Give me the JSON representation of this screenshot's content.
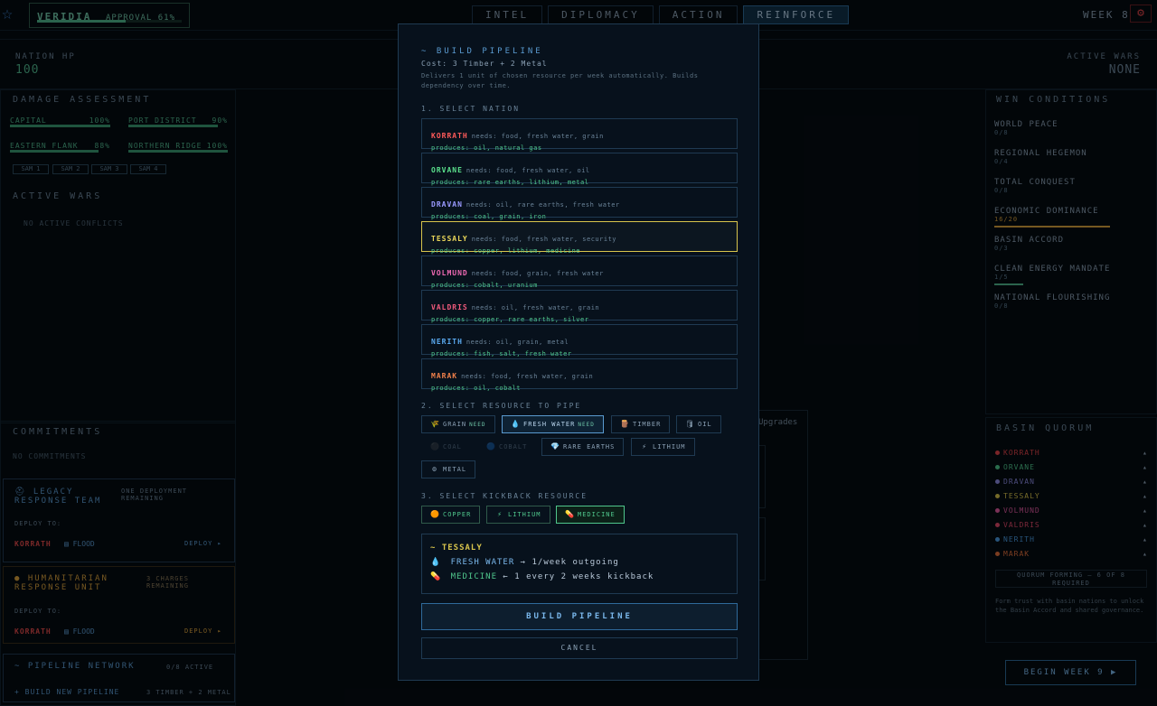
{
  "topbar": {
    "nation": "VERIDIA",
    "approval": "APPROVAL 61%",
    "approval_fill": 0.61,
    "tabs": [
      {
        "label": "INTEL",
        "active": false
      },
      {
        "label": "DIPLOMACY",
        "active": false
      },
      {
        "label": "ACTION",
        "active": false
      },
      {
        "label": "REINFORCE",
        "active": true
      }
    ],
    "week": "WEEK 8",
    "settings_icon": "gear-icon"
  },
  "stats": {
    "nation_hp_label": "NATION HP",
    "nation_hp": "100",
    "active_wars_label": "ACTIVE WARS",
    "active_wars": "NONE"
  },
  "damage": {
    "title": "DAMAGE ASSESSMENT",
    "regions": [
      {
        "name": "CAPITAL",
        "pct": "100%",
        "level": 1.0
      },
      {
        "name": "PORT DISTRICT",
        "pct": "90%",
        "level": 0.9
      },
      {
        "name": "EASTERN FLANK",
        "pct": "88%",
        "level": 0.88
      },
      {
        "name": "NORTHERN RIDGE",
        "pct": "100%",
        "level": 1.0
      }
    ],
    "sams": [
      "SAM 1",
      "SAM 2",
      "SAM 3",
      "SAM 4"
    ]
  },
  "wars": {
    "title": "ACTIVE WARS",
    "empty": "NO ACTIVE CONFLICTS"
  },
  "commitments": {
    "title": "COMMITMENTS",
    "empty": "NO COMMITMENTS",
    "units": [
      {
        "name": "LEGACY RESPONSE TEAM",
        "remaining": "ONE DEPLOYMENT REMAINING",
        "deploy_to": "DEPLOY TO:",
        "target": "KORRATH",
        "event": "FLOOD",
        "action": "DEPLOY ▸"
      },
      {
        "name": "HUMANITARIAN RESPONSE UNIT",
        "remaining": "3 CHARGES REMAINING",
        "deploy_to": "DEPLOY TO:",
        "target": "KORRATH",
        "event": "FLOOD",
        "action": "DEPLOY ▸"
      }
    ]
  },
  "pipeline_network": {
    "title": "~ PIPELINE NETWORK",
    "count": "0/8 ACTIVE",
    "build_link": "+ BUILD NEW PIPELINE",
    "build_cost": "3 TIMBER + 2 METAL"
  },
  "center_bg": {
    "tab": "Upgrades"
  },
  "win_conditions": {
    "title": "WIN CONDITIONS",
    "items": [
      {
        "name": "WORLD PEACE",
        "sub": "0/8",
        "level": 0,
        "color": "#4fb68c"
      },
      {
        "name": "REGIONAL HEGEMON",
        "sub": "0/4",
        "level": 0,
        "color": "#4fb68c"
      },
      {
        "name": "TOTAL CONQUEST",
        "sub": "0/8",
        "level": 0,
        "color": "#4fb68c"
      },
      {
        "name": "ECONOMIC DOMINANCE",
        "sub": "16/20",
        "level": 0.8,
        "color": "#d8a03c"
      },
      {
        "name": "BASIN ACCORD",
        "sub": "0/3",
        "level": 0,
        "color": "#4fb68c"
      },
      {
        "name": "CLEAN ENERGY MANDATE",
        "sub": "1/5",
        "level": 0.2,
        "color": "#4fb68c"
      },
      {
        "name": "NATIONAL FLOURISHING",
        "sub": "0/8",
        "level": 0,
        "color": "#4fb68c"
      }
    ]
  },
  "quorum": {
    "title": "BASIN QUORUM",
    "nations": [
      {
        "name": "KORRATH",
        "color": "#e0444a"
      },
      {
        "name": "ORVANE",
        "color": "#4fc68c"
      },
      {
        "name": "DRAVAN",
        "color": "#8a8ae0"
      },
      {
        "name": "TESSALY",
        "color": "#d8c44c"
      },
      {
        "name": "VOLMUND",
        "color": "#e05aa0"
      },
      {
        "name": "VALDRIS",
        "color": "#e04a6a"
      },
      {
        "name": "NERITH",
        "color": "#4a9ae0"
      },
      {
        "name": "MARAK",
        "color": "#e0703c"
      }
    ],
    "note_title": "QUORUM FORMING — 6 OF 8 REQUIRED",
    "note": "Form trust with basin nations to unlock the Basin Accord and shared governance.",
    "begin": "BEGIN WEEK 9 ▶"
  },
  "modal": {
    "title": "~ BUILD PIPELINE",
    "cost": "Cost: 3 Timber + 2 Metal",
    "desc": "Delivers 1 unit of chosen resource per week automatically. Builds dependency over time.",
    "sec1": "1. SELECT NATION",
    "nations": [
      {
        "name": "KORRATH",
        "color": "#ff5a5a",
        "needs": "needs: food, fresh water, grain",
        "produces": "produces: oil, natural gas",
        "selected": false
      },
      {
        "name": "ORVANE",
        "color": "#5ae08c",
        "needs": "needs: food, fresh water, oil",
        "produces": "produces: rare earths, lithium, metal",
        "selected": false
      },
      {
        "name": "DRAVAN",
        "color": "#9a9aff",
        "needs": "needs: oil, rare earths, fresh water",
        "produces": "produces: coal, grain, iron",
        "selected": false
      },
      {
        "name": "TESSALY",
        "color": "#ecd85a",
        "needs": "needs: food, fresh water, security",
        "produces": "produces: copper, lithium, medicine",
        "selected": true
      },
      {
        "name": "VOLMUND",
        "color": "#f06ab4",
        "needs": "needs: food, grain, fresh water",
        "produces": "produces: cobalt, uranium",
        "selected": false
      },
      {
        "name": "VALDRIS",
        "color": "#f05a7c",
        "needs": "needs: oil, fresh water, grain",
        "produces": "produces: copper, rare earths, silver",
        "selected": false
      },
      {
        "name": "NERITH",
        "color": "#5aaaf0",
        "needs": "needs: oil, grain, metal",
        "produces": "produces: fish, salt, fresh water",
        "selected": false
      },
      {
        "name": "MARAK",
        "color": "#f0804a",
        "needs": "needs: food, fresh water, grain",
        "produces": "produces: oil, cobalt",
        "selected": false
      }
    ],
    "sec2": "2. SELECT RESOURCE TO PIPE",
    "resources": [
      {
        "label": "GRAIN",
        "icon": "🌾",
        "need": "NEED",
        "state": "normal"
      },
      {
        "label": "FRESH WATER",
        "icon": "💧",
        "need": "NEED",
        "state": "selected"
      },
      {
        "label": "TIMBER",
        "icon": "🪵",
        "need": "",
        "state": "normal"
      },
      {
        "label": "OIL",
        "icon": "🛢",
        "need": "",
        "state": "normal"
      },
      {
        "label": "COAL",
        "icon": "⚫",
        "need": "",
        "state": "disabled"
      },
      {
        "label": "COBALT",
        "icon": "🔵",
        "need": "",
        "state": "disabled"
      },
      {
        "label": "RARE EARTHS",
        "icon": "💎",
        "need": "",
        "state": "normal"
      },
      {
        "label": "LITHIUM",
        "icon": "⚡",
        "need": "",
        "state": "normal"
      },
      {
        "label": "METAL",
        "icon": "⚙",
        "need": "",
        "state": "normal"
      }
    ],
    "sec3": "3. SELECT KICKBACK RESOURCE",
    "kickbacks": [
      {
        "label": "COPPER",
        "icon": "🟠",
        "state": "normal"
      },
      {
        "label": "LITHIUM",
        "icon": "⚡",
        "state": "normal"
      },
      {
        "label": "MEDICINE",
        "icon": "💊",
        "state": "selected"
      }
    ],
    "summary": {
      "nation": "~ TESSALY",
      "out_icon": "💧",
      "out_label": "FRESH WATER",
      "out_text": "→ 1/week outgoing",
      "in_icon": "💊",
      "in_label": "MEDICINE",
      "in_text": "← 1 every 2 weeks kickback"
    },
    "build": "BUILD PIPELINE",
    "cancel": "CANCEL"
  }
}
